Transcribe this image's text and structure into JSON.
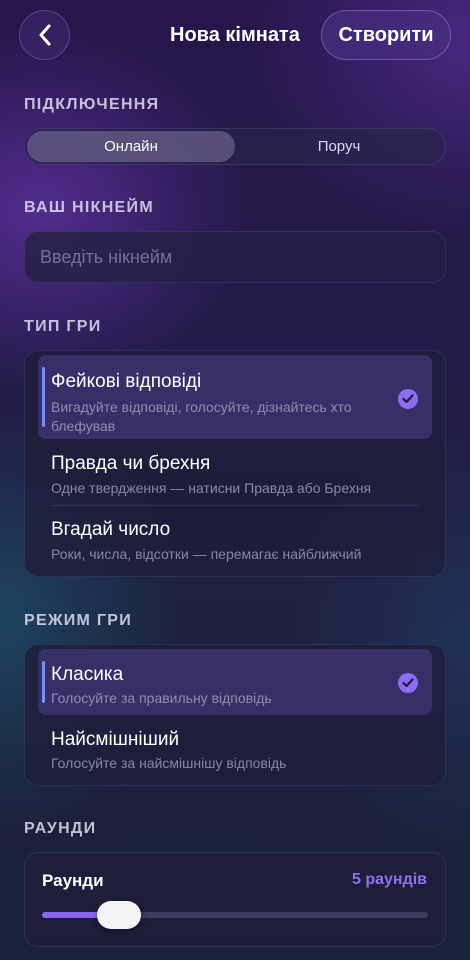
{
  "header": {
    "title": "Нова кімната",
    "create_label": "Створити",
    "back_icon": "chevron-left-icon"
  },
  "connection": {
    "label": "ПІДКЛЮЧЕННЯ",
    "options": [
      "Онлайн",
      "Поруч"
    ],
    "selected": "Онлайн"
  },
  "nickname": {
    "label": "ВАШ НІКНЕЙМ",
    "placeholder": "Введіть нікнейм",
    "value": ""
  },
  "game_type": {
    "label": "ТИП ГРИ",
    "options": [
      {
        "title": "Фейкові відповіді",
        "subtitle": "Вигадуйте відповіді, голосуйте, дізнайтесь хто блефував",
        "selected": true
      },
      {
        "title": "Правда чи брехня",
        "subtitle": "Одне твердження — натисни Правда або Брехня",
        "selected": false
      },
      {
        "title": "Вгадай число",
        "subtitle": "Роки, числа, відсотки — перемагає найближчий",
        "selected": false
      }
    ]
  },
  "game_mode": {
    "label": "РЕЖИМ ГРИ",
    "options": [
      {
        "title": "Класика",
        "subtitle": "Голосуйте за правильну відповідь",
        "selected": true
      },
      {
        "title": "Найсмішніший",
        "subtitle": "Голосуйте за найсмішнішу відповідь",
        "selected": false
      }
    ]
  },
  "rounds": {
    "label": "РАУНДИ",
    "slider_label": "Раунди",
    "value_text": "5 раундів",
    "slider_fraction": 0.13
  },
  "colors": {
    "accent": "#8b6cf2",
    "selected_bar": "#7a8cf5",
    "value_text": "#8f6ef4"
  }
}
